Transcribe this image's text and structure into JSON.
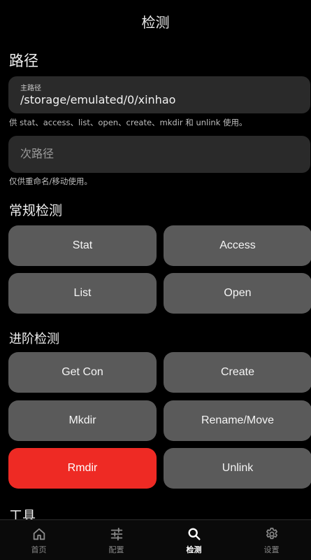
{
  "header": {
    "title": "检测"
  },
  "path_section": {
    "title": "路径",
    "primary": {
      "label": "主路径",
      "value": "/storage/emulated/0/xinhao"
    },
    "primary_helper": "供 stat、access、list、open、create、mkdir 和 unlink 使用。",
    "secondary": {
      "placeholder": "次路径",
      "value": ""
    },
    "secondary_helper": "仅供重命名/移动使用。"
  },
  "common_section": {
    "title": "常规检测",
    "buttons": [
      "Stat",
      "Access",
      "List",
      "Open"
    ]
  },
  "advanced_section": {
    "title": "进阶检测",
    "buttons": [
      "Get Con",
      "Create",
      "Mkdir",
      "Rename/Move",
      "Rmdir",
      "Unlink"
    ],
    "danger_color": "#ee2a24"
  },
  "tools_section": {
    "title": "工具"
  },
  "nav": {
    "items": [
      {
        "label": "首页",
        "icon": "home-icon"
      },
      {
        "label": "配置",
        "icon": "sliders-icon"
      },
      {
        "label": "检测",
        "icon": "search-icon"
      },
      {
        "label": "设置",
        "icon": "gear-icon"
      }
    ],
    "active": "检测"
  }
}
